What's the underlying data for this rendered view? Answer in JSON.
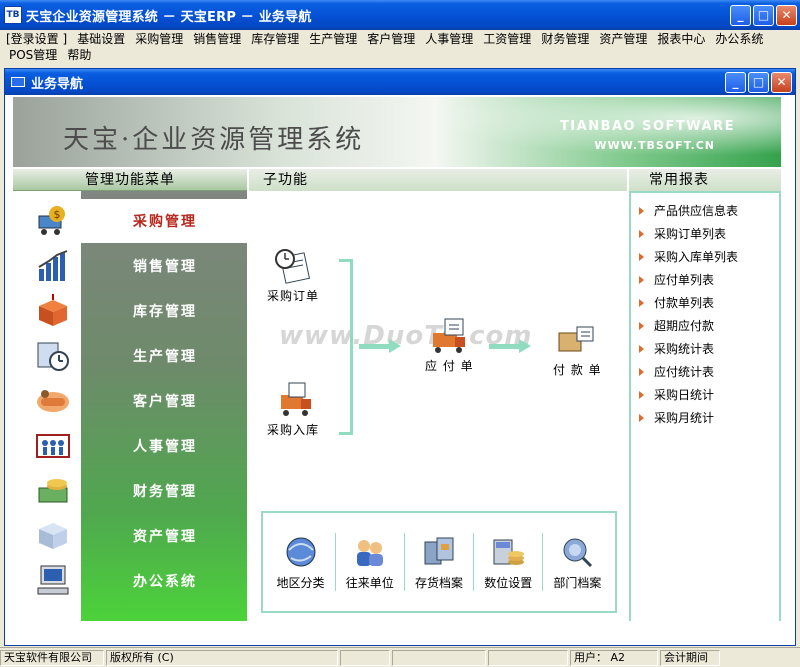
{
  "window": {
    "title": "天宝企业资源管理系统 － 天宝ERP － 业务导航",
    "app_icon_text": "TB",
    "minimize_label": "_",
    "maximize_label": "□",
    "close_label": "✕"
  },
  "menubar": {
    "items": [
      "[登录设置 ]",
      "基础设置",
      "采购管理",
      "销售管理",
      "库存管理",
      "生产管理",
      "客户管理",
      "人事管理",
      "工资管理",
      "财务管理",
      "资产管理",
      "报表中心",
      "办公系统",
      "POS管理",
      "帮助"
    ]
  },
  "inner_window": {
    "title": "业务导航"
  },
  "banner": {
    "title": "天宝·企业资源管理系统",
    "en_title": "TIANBAO SOFTWARE",
    "url": "WWW.TBSOFT.CN"
  },
  "left_panel": {
    "header": "管理功能菜单",
    "items": [
      {
        "label": "采购管理",
        "icon": "purchase-cart-icon",
        "selected": true
      },
      {
        "label": "销售管理",
        "icon": "sales-chart-icon",
        "selected": false
      },
      {
        "label": "库存管理",
        "icon": "inventory-box-icon",
        "selected": false
      },
      {
        "label": "生产管理",
        "icon": "production-clock-icon",
        "selected": false
      },
      {
        "label": "客户管理",
        "icon": "customer-handshake-icon",
        "selected": false
      },
      {
        "label": "人事管理",
        "icon": "personnel-people-icon",
        "selected": false
      },
      {
        "label": "财务管理",
        "icon": "finance-money-icon",
        "selected": false
      },
      {
        "label": "资产管理",
        "icon": "asset-box-icon",
        "selected": false
      },
      {
        "label": "办公系统",
        "icon": "office-computer-icon",
        "selected": false
      }
    ]
  },
  "middle_panel": {
    "header": "子功能",
    "watermark": "www.DuoTe.com",
    "flow": {
      "purchase_order": "采购订单",
      "purchase_receipt": "采购入库",
      "payable": "应 付 单",
      "payment": "付 款 单"
    },
    "tools": [
      {
        "label": "地区分类",
        "icon": "region-globe-icon"
      },
      {
        "label": "往来单位",
        "icon": "contacts-people-icon"
      },
      {
        "label": "存货档案",
        "icon": "stock-archive-icon"
      },
      {
        "label": "数位设置",
        "icon": "digit-settings-icon"
      },
      {
        "label": "部门档案",
        "icon": "department-archive-icon"
      }
    ]
  },
  "right_panel": {
    "header": "常用报表",
    "links": [
      "产品供应信息表",
      "采购订单列表",
      "采购入库单列表",
      "应付单列表",
      "付款单列表",
      "超期应付款",
      "采购统计表",
      "应付统计表",
      "采购日统计",
      "采购月统计"
    ]
  },
  "statusbar": {
    "company": "天宝软件有限公司",
    "copyright": "版权所有 (C)",
    "user": "用户： A2",
    "period": "会计期间"
  },
  "colors": {
    "titlebar": "#0552d6",
    "accent_green": "#4cd23a",
    "selected_text": "#b8281e",
    "bullet": "#e16a2a"
  }
}
